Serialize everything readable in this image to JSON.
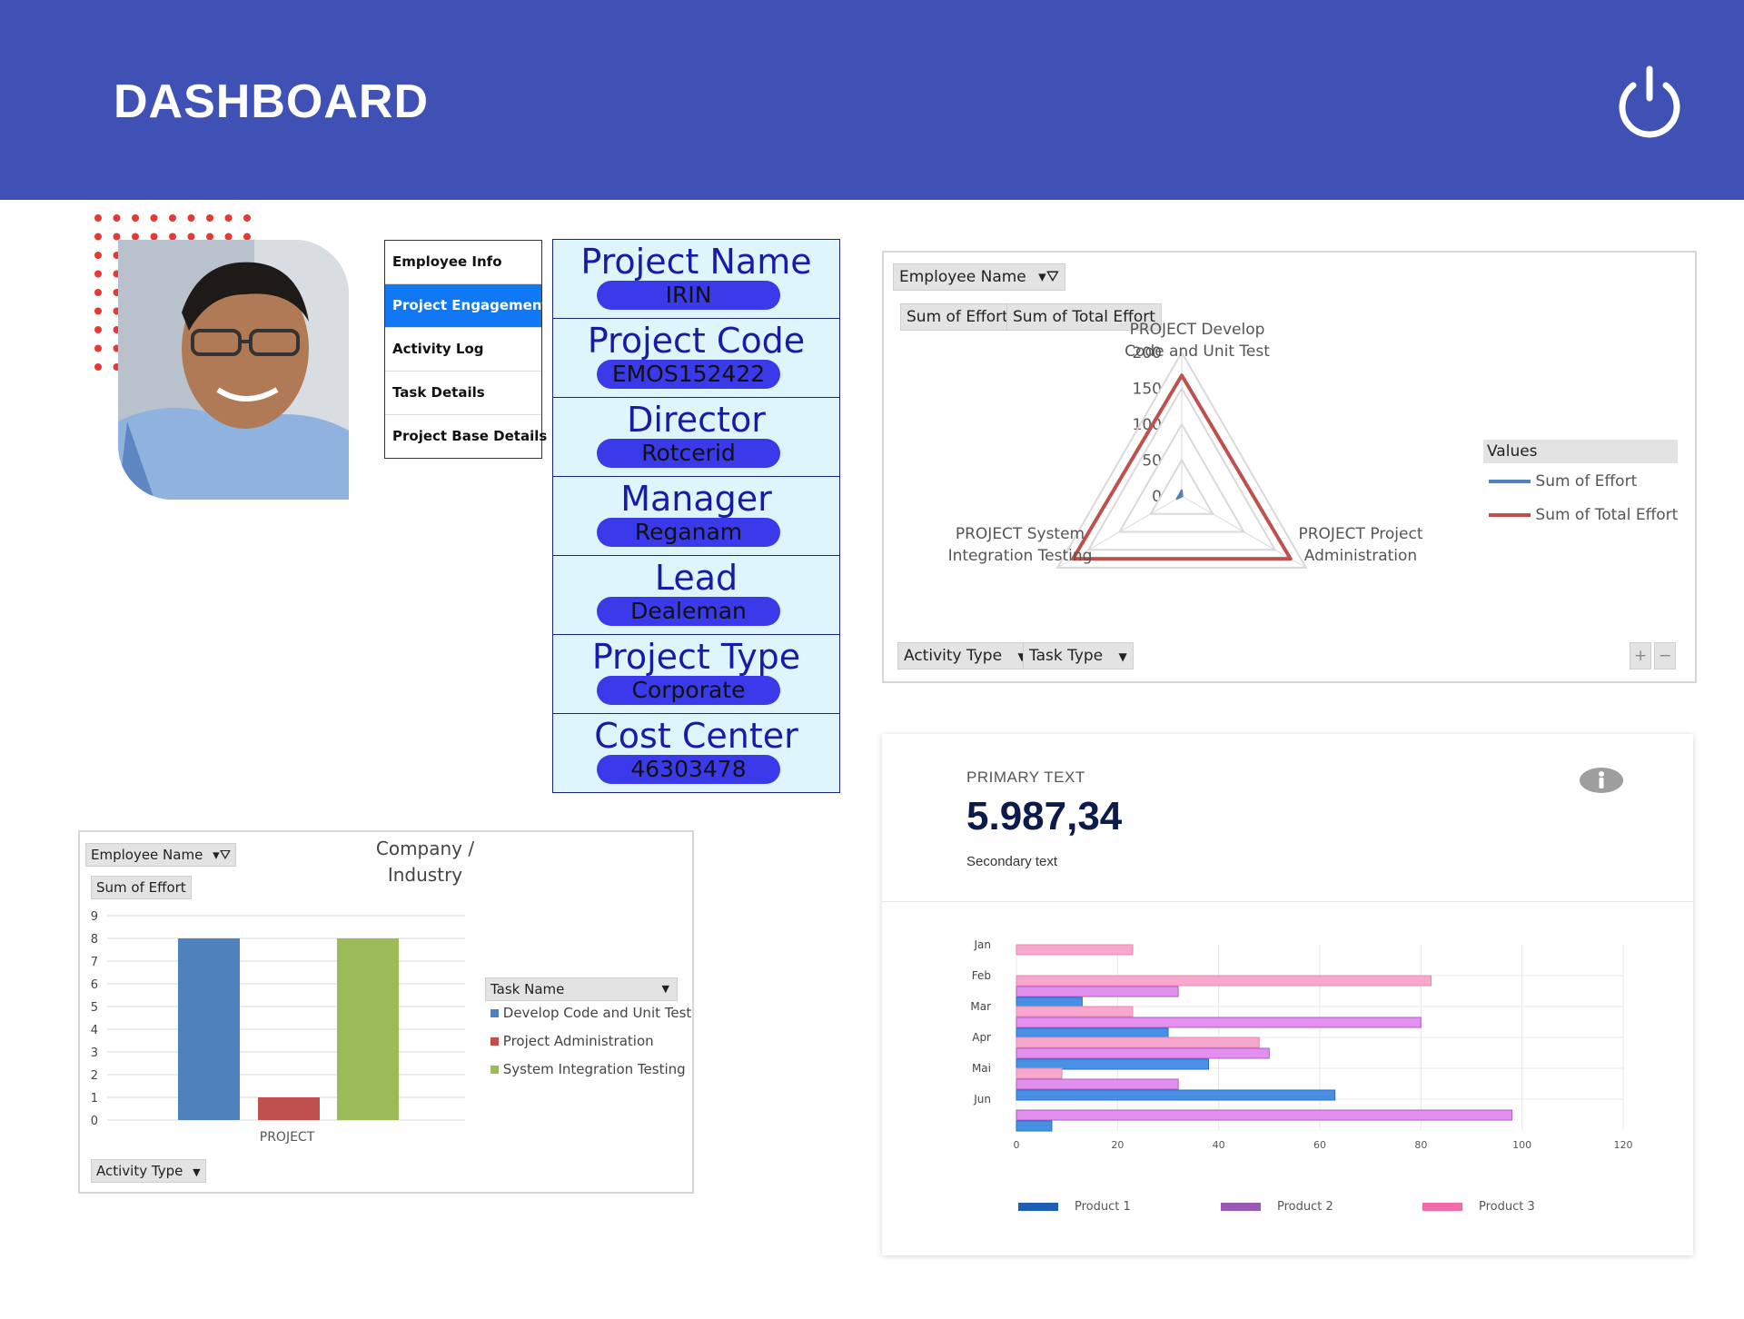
{
  "header": {
    "title": "DASHBOARD",
    "power_icon": "power-icon",
    "background": "#3f51b5"
  },
  "sidenav": {
    "items": [
      {
        "label": "Employee Info",
        "active": false
      },
      {
        "label": "Project Engagement",
        "active": true
      },
      {
        "label": "Activity Log",
        "active": false
      },
      {
        "label": "Task Details",
        "active": false
      },
      {
        "label": "Project Base Details",
        "active": false
      }
    ]
  },
  "project_info": [
    {
      "label": "Project Name",
      "value": "IRIN"
    },
    {
      "label": "Project Code",
      "value": "EMOS152422"
    },
    {
      "label": "Director",
      "value": "Rotcerid"
    },
    {
      "label": "Manager",
      "value": "Reganam"
    },
    {
      "label": "Lead",
      "value": "Dealeman"
    },
    {
      "label": "Project Type",
      "value": "Corporate"
    },
    {
      "label": "Cost Center",
      "value": "46303478"
    }
  ],
  "radar_panel": {
    "filter_button": "Employee Name",
    "field_buttons": [
      "Sum of Effort",
      "Sum of Total Effort"
    ],
    "bottom_buttons": [
      "Activity Type",
      "Task Type"
    ],
    "zoom_in": "+",
    "zoom_out": "−",
    "legend_title": "Values",
    "chart_data": {
      "type": "radar",
      "axes": [
        "PROJECT Develop Code and Unit Test",
        "PROJECT Project Administration",
        "PROJECT System Integration Testing"
      ],
      "axis_label_lines": [
        [
          "PROJECT Develop",
          "Code and Unit Test"
        ],
        [
          "PROJECT Project",
          "Administration"
        ],
        [
          "PROJECT System",
          "Integration Testing"
        ]
      ],
      "ticks": [
        "0",
        "50",
        "100",
        "150",
        "200"
      ],
      "rmax": 200,
      "series": [
        {
          "name": "Sum of Effort",
          "color": "#4f81bd",
          "values": [
            8,
            1,
            8
          ]
        },
        {
          "name": "Sum of Total Effort",
          "color": "#c0504d",
          "values": [
            168,
            175,
            175
          ]
        }
      ]
    }
  },
  "kpi": {
    "primary_text": "PRIMARY TEXT",
    "value": "5.987,34",
    "secondary_text": "Secondary text",
    "info_icon": "info-icon"
  },
  "product_chart": {
    "chart_data": {
      "type": "bar",
      "orientation": "horizontal",
      "categories": [
        "Jan",
        "Feb",
        "Mar",
        "Apr",
        "Mai",
        "Jun"
      ],
      "xlim": [
        0,
        120
      ],
      "xticks": [
        "0",
        "20",
        "40",
        "60",
        "80",
        "100",
        "120"
      ],
      "series": [
        {
          "name": "Product 1",
          "color": "#4a90e2",
          "values": [
            0,
            13,
            30,
            38,
            63,
            7
          ]
        },
        {
          "name": "Product 2",
          "color": "#e28ff0",
          "values": [
            0,
            32,
            80,
            50,
            32,
            98
          ]
        },
        {
          "name": "Product 3",
          "color": "#f7a8cc",
          "values": [
            23,
            82,
            23,
            48,
            9,
            0
          ]
        }
      ]
    }
  },
  "company_panel": {
    "filter_button": "Employee Name",
    "field_button": "Sum of Effort",
    "title": "Company / Industry",
    "title_lines": [
      "Company /",
      "Industry"
    ],
    "legend_title": "Task Name",
    "bottom_button": "Activity Type",
    "chart_data": {
      "type": "bar",
      "categories": [
        "PROJECT"
      ],
      "series": [
        {
          "name": "Develop Code and Unit Test",
          "color": "#4f81bd",
          "values": [
            8
          ]
        },
        {
          "name": "Project Administration",
          "color": "#c0504d",
          "values": [
            1
          ]
        },
        {
          "name": "System Integration Testing",
          "color": "#9bbb59",
          "values": [
            8
          ]
        }
      ],
      "ylim": [
        0,
        9
      ],
      "yticks": [
        "0",
        "1",
        "2",
        "3",
        "4",
        "5",
        "6",
        "7",
        "8",
        "9"
      ]
    }
  }
}
